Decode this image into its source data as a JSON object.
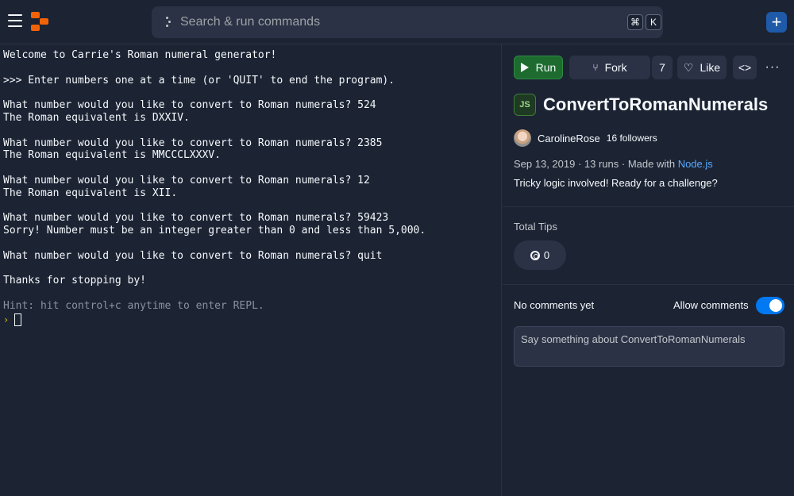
{
  "topbar": {
    "search_placeholder": "Search & run commands",
    "shortcut_keys": [
      "⌘",
      "K"
    ],
    "plus_label": "+",
    "accent_color": "#f26207"
  },
  "console": {
    "lines": [
      "Welcome to Carrie's Roman numeral generator!",
      "",
      ">>> Enter numbers one at a time (or 'QUIT' to end the program).",
      "",
      "What number would you like to convert to Roman numerals? 524",
      "The Roman equivalent is DXXIV.",
      "",
      "What number would you like to convert to Roman numerals? 2385",
      "The Roman equivalent is MMCCCLXXXV.",
      "",
      "What number would you like to convert to Roman numerals? 12",
      "The Roman equivalent is XII.",
      "",
      "What number would you like to convert to Roman numerals? 59423",
      "Sorry! Number must be an integer greater than 0 and less than 5,000.",
      "",
      "What number would you like to convert to Roman numerals? quit",
      "",
      "Thanks for stopping by!",
      ""
    ],
    "hint": "Hint: hit control+c anytime to enter REPL.",
    "prompt_symbol": "›"
  },
  "panel": {
    "run_label": "Run",
    "fork_label": "Fork",
    "fork_count": "7",
    "like_label": "Like",
    "code_label": "<>",
    "more_label": "···",
    "language_badge": "JS",
    "title": "ConvertToRomanNumerals",
    "author": "CarolineRose",
    "followers": "16 followers",
    "meta_prefix": "Sep 13, 2019 · 13 runs · Made with ",
    "meta_link": "Node.js",
    "description": "Tricky logic involved! Ready for a challenge?",
    "tips_label": "Total Tips",
    "tips_value": "0",
    "comments_label": "No comments yet",
    "allow_comments_label": "Allow comments",
    "allow_comments_on": true,
    "comment_placeholder": "Say something about ConvertToRomanNumerals"
  }
}
